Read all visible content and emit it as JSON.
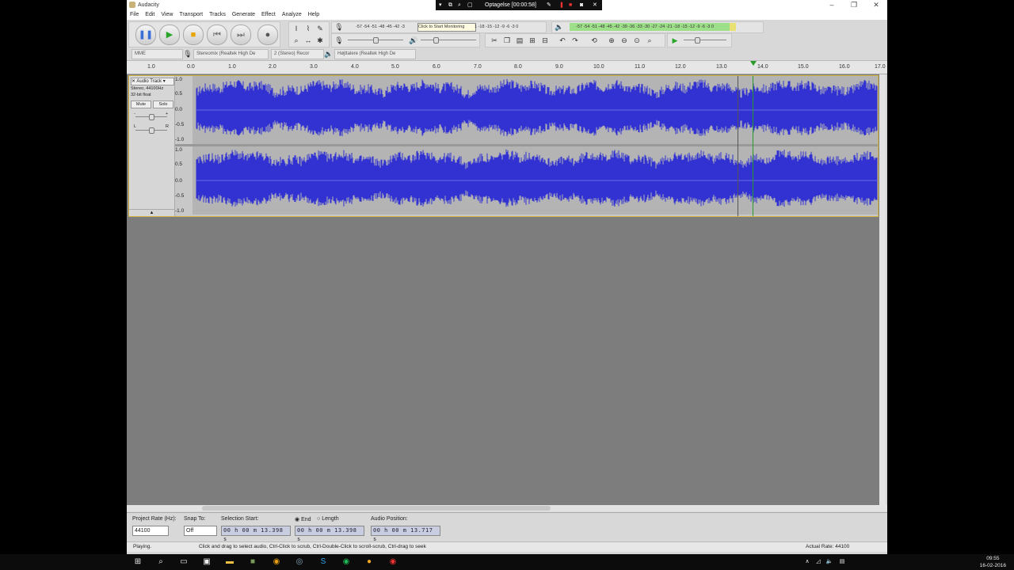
{
  "window": {
    "title": "Audacity"
  },
  "menu": [
    "File",
    "Edit",
    "View",
    "Transport",
    "Tracks",
    "Generate",
    "Effect",
    "Analyze",
    "Help"
  ],
  "recorder": {
    "label": "Optagelse [00:00:58]"
  },
  "meters": {
    "record_scale": "-57 -54 -51 -48 -45 -42 -3",
    "record_tooltip": "Click to Start Monitoring",
    "record_scale_tail": "1 -18 -15 -12 -9 -6 -3 0",
    "play_scale": "-57 -54 -51 -48 -45 -42 -39 -36 -33 -30 -27 -24 -21 -18 -15 -12 -9 -6 -3 0",
    "record_channels": "L R",
    "play_channels": "L R"
  },
  "devices": {
    "host": "MME",
    "recording_device": "Stereomix (Realtek High De",
    "channels": "2 (Stereo) Recor",
    "playback_device": "Højttalere (Realtek High De"
  },
  "ruler": {
    "ticks": [
      "1.0",
      "0.0",
      "1.0",
      "2.0",
      "3.0",
      "4.0",
      "5.0",
      "6.0",
      "7.0",
      "8.0",
      "9.0",
      "10.0",
      "11.0",
      "12.0",
      "13.0",
      "14.0",
      "15.0",
      "16.0",
      "17.0"
    ]
  },
  "track": {
    "name": "Audio Track",
    "format_line1": "Stereo, 44100Hz",
    "format_line2": "32-bit float",
    "mute": "Mute",
    "solo": "Solo",
    "gain_left": "-",
    "gain_right": "+",
    "pan_left": "L",
    "pan_right": "R",
    "scale": [
      "1.0",
      "0.5",
      "0.0",
      "-0.5",
      "-1.0"
    ]
  },
  "selection_bar": {
    "project_rate_label": "Project Rate (Hz):",
    "project_rate": "44100",
    "snap_label": "Snap To:",
    "snap_value": "Off",
    "sel_start_label": "Selection Start:",
    "end_label": "End",
    "length_label": "Length",
    "audio_pos_label": "Audio Position:",
    "sel_start": "00 h 00 m 13.398 s",
    "sel_end": "00 h 00 m 13.398 s",
    "audio_pos": "00 h 00 m 13.717 s"
  },
  "status": {
    "state": "Playing.",
    "hint": "Click and drag to select audio, Ctrl-Click to scrub, Ctrl-Double-Click to scroll-scrub, Ctrl-drag to seek",
    "rate": "Actual Rate: 44100"
  },
  "taskbar": {
    "time": "09:55",
    "date": "16-02-2016"
  },
  "colors": {
    "waveform": "#3232d2",
    "cursor": "#2a9a2a",
    "meter_green": "#9ee08a"
  }
}
